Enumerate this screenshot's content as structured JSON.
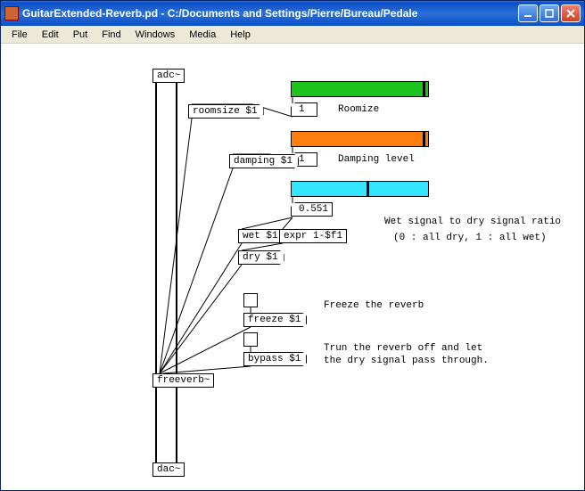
{
  "window": {
    "title": "GuitarExtended-Reverb.pd  - C:/Documents and Settings/Pierre/Bureau/Pedale"
  },
  "menu": {
    "file": "File",
    "edit": "Edit",
    "put": "Put",
    "find": "Find",
    "windows": "Windows",
    "media": "Media",
    "help": "Help"
  },
  "objects": {
    "adc": "adc~",
    "roomsize": "roomsize $1",
    "damping": "damping $1",
    "wet": "wet $1",
    "expr": "expr 1-$f1",
    "dry": "dry $1",
    "freeze": "freeze $1",
    "bypass": "bypass $1",
    "freeverb": "freeverb~",
    "dac": "dac~"
  },
  "numbers": {
    "roomsize": "1",
    "damping": "1",
    "wet": "0.551"
  },
  "sliders": {
    "roomsize": {
      "color": "#1ec31e",
      "pos": 0.97
    },
    "damping": {
      "color": "#ff7f0e",
      "pos": 0.97
    },
    "wet": {
      "color": "#33e5ff",
      "pos": 0.55
    }
  },
  "comments": {
    "roomsize": "Roomize",
    "damping": "Damping level",
    "wet1": "Wet signal to dry signal ratio",
    "wet2": "(0 : all dry, 1 : all wet)",
    "freeze": "Freeze the reverb",
    "bypass1": "Trun the reverb off and let",
    "bypass2": "the dry signal pass through."
  }
}
